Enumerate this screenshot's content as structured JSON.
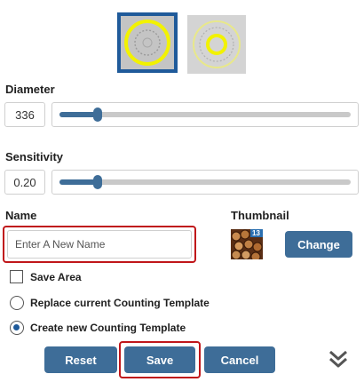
{
  "templates": [
    {
      "name": "template-option-large",
      "selected": true
    },
    {
      "name": "template-option-small",
      "selected": false
    }
  ],
  "diameter": {
    "label": "Diameter",
    "value": "336",
    "slider_fraction": 0.13
  },
  "sensitivity": {
    "label": "Sensitivity",
    "value": "0.20",
    "slider_fraction": 0.13
  },
  "name_field": {
    "label": "Name",
    "placeholder": "Enter A New Name",
    "value": ""
  },
  "thumbnail": {
    "label": "Thumbnail",
    "change_label": "Change",
    "badge": "13"
  },
  "options": {
    "save_area": {
      "label": "Save Area",
      "checked": false
    },
    "replace": {
      "label": "Replace current Counting Template",
      "selected": false
    },
    "create": {
      "label": "Create new Counting Template",
      "selected": true
    }
  },
  "buttons": {
    "reset": "Reset",
    "save": "Save",
    "cancel": "Cancel"
  },
  "icons": {
    "collapse": "double-chevron-down-icon"
  },
  "colors": {
    "accent": "#3e6d98",
    "selected_border": "#1f5a9a",
    "highlight": "#c0161a",
    "ring": "#f2f200"
  }
}
